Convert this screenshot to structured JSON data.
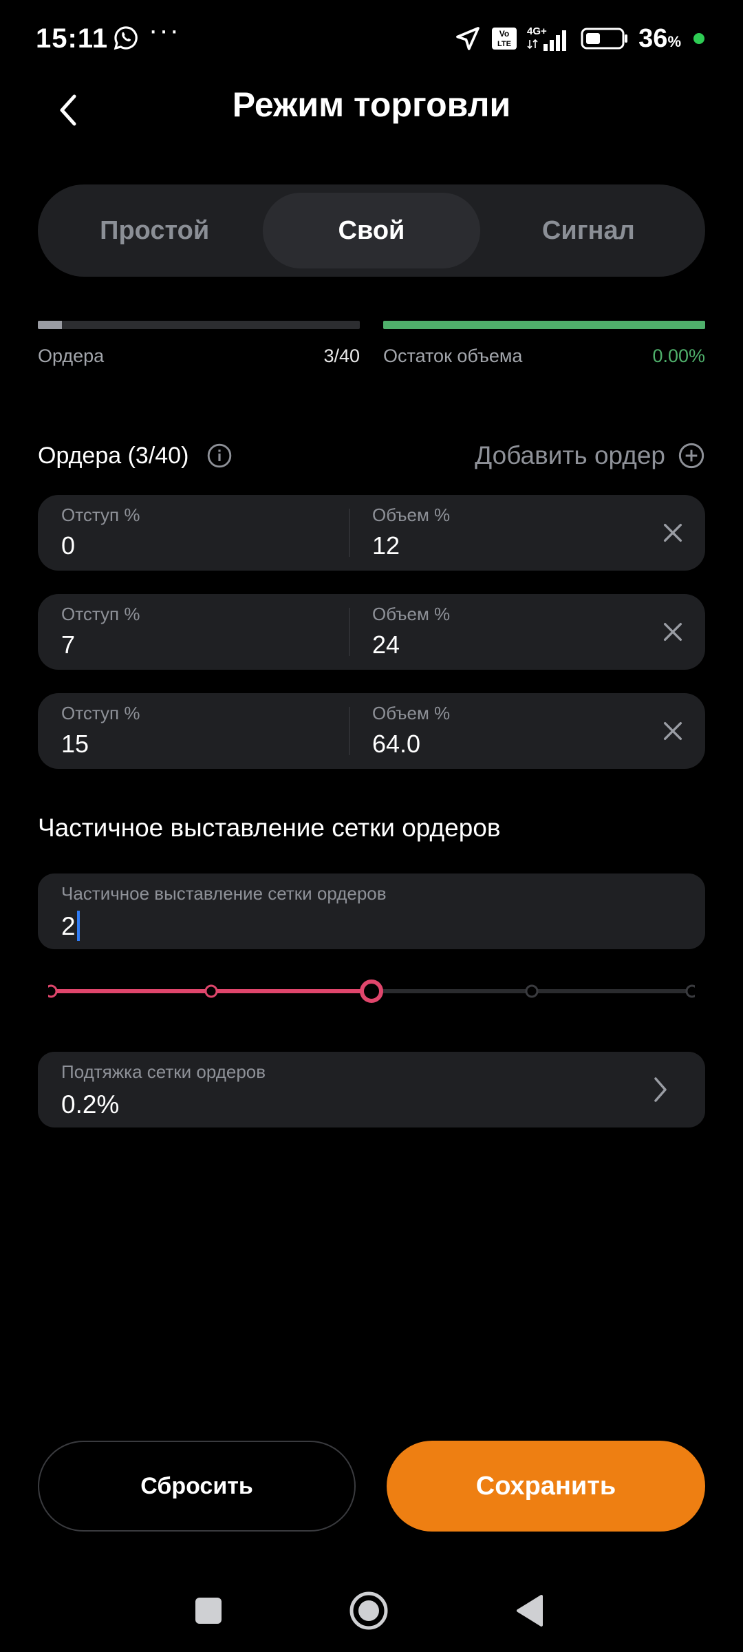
{
  "status_bar": {
    "time": "15:11",
    "network": "4G+",
    "volte": "Vo LTE",
    "battery_percent": "36",
    "battery_unit": "%",
    "icons": [
      "whatsapp-icon",
      "more-dots-icon",
      "location-arrow-icon",
      "volte-icon",
      "signal-icon",
      "battery-icon"
    ]
  },
  "header": {
    "title": "Режим торговли",
    "back_icon": "chevron-left-icon"
  },
  "mode_tabs": [
    {
      "label": "Простой",
      "active": false
    },
    {
      "label": "Свой",
      "active": true
    },
    {
      "label": "Сигнал",
      "active": false
    }
  ],
  "progress": {
    "orders": {
      "label": "Ордера",
      "value": "3/40",
      "fraction": 0.075,
      "color": "#9a9ca3"
    },
    "remaining": {
      "label": "Остаток объема",
      "value": "0.00%",
      "fraction": 1.0,
      "color": "#4fb06b"
    }
  },
  "orders_section": {
    "title": "Ордера (3/40)",
    "add_label": "Добавить ордер",
    "orders": [
      {
        "offset_label": "Отступ %",
        "offset": "0",
        "volume_label": "Объем %",
        "volume": "12"
      },
      {
        "offset_label": "Отступ %",
        "offset": "7",
        "volume_label": "Объем %",
        "volume": "24"
      },
      {
        "offset_label": "Отступ %",
        "offset": "15",
        "volume_label": "Объем %",
        "volume": "64.0"
      }
    ]
  },
  "partial_grid": {
    "section_title": "Частичное выставление сетки ордеров",
    "field_label": "Частичное выставление сетки ордеров",
    "value": "2",
    "slider": {
      "steps": 5,
      "selected_index": 2,
      "active_color": "#e0466c"
    }
  },
  "grid_pullup": {
    "label": "Подтяжка сетки ордеров",
    "value": "0.2%"
  },
  "buttons": {
    "reset": "Сбросить",
    "save": "Сохранить"
  },
  "colors": {
    "accent_orange": "#ee7f12",
    "accent_pink": "#e0466c",
    "success_green": "#4fb06b",
    "card_bg": "#1f2023"
  }
}
